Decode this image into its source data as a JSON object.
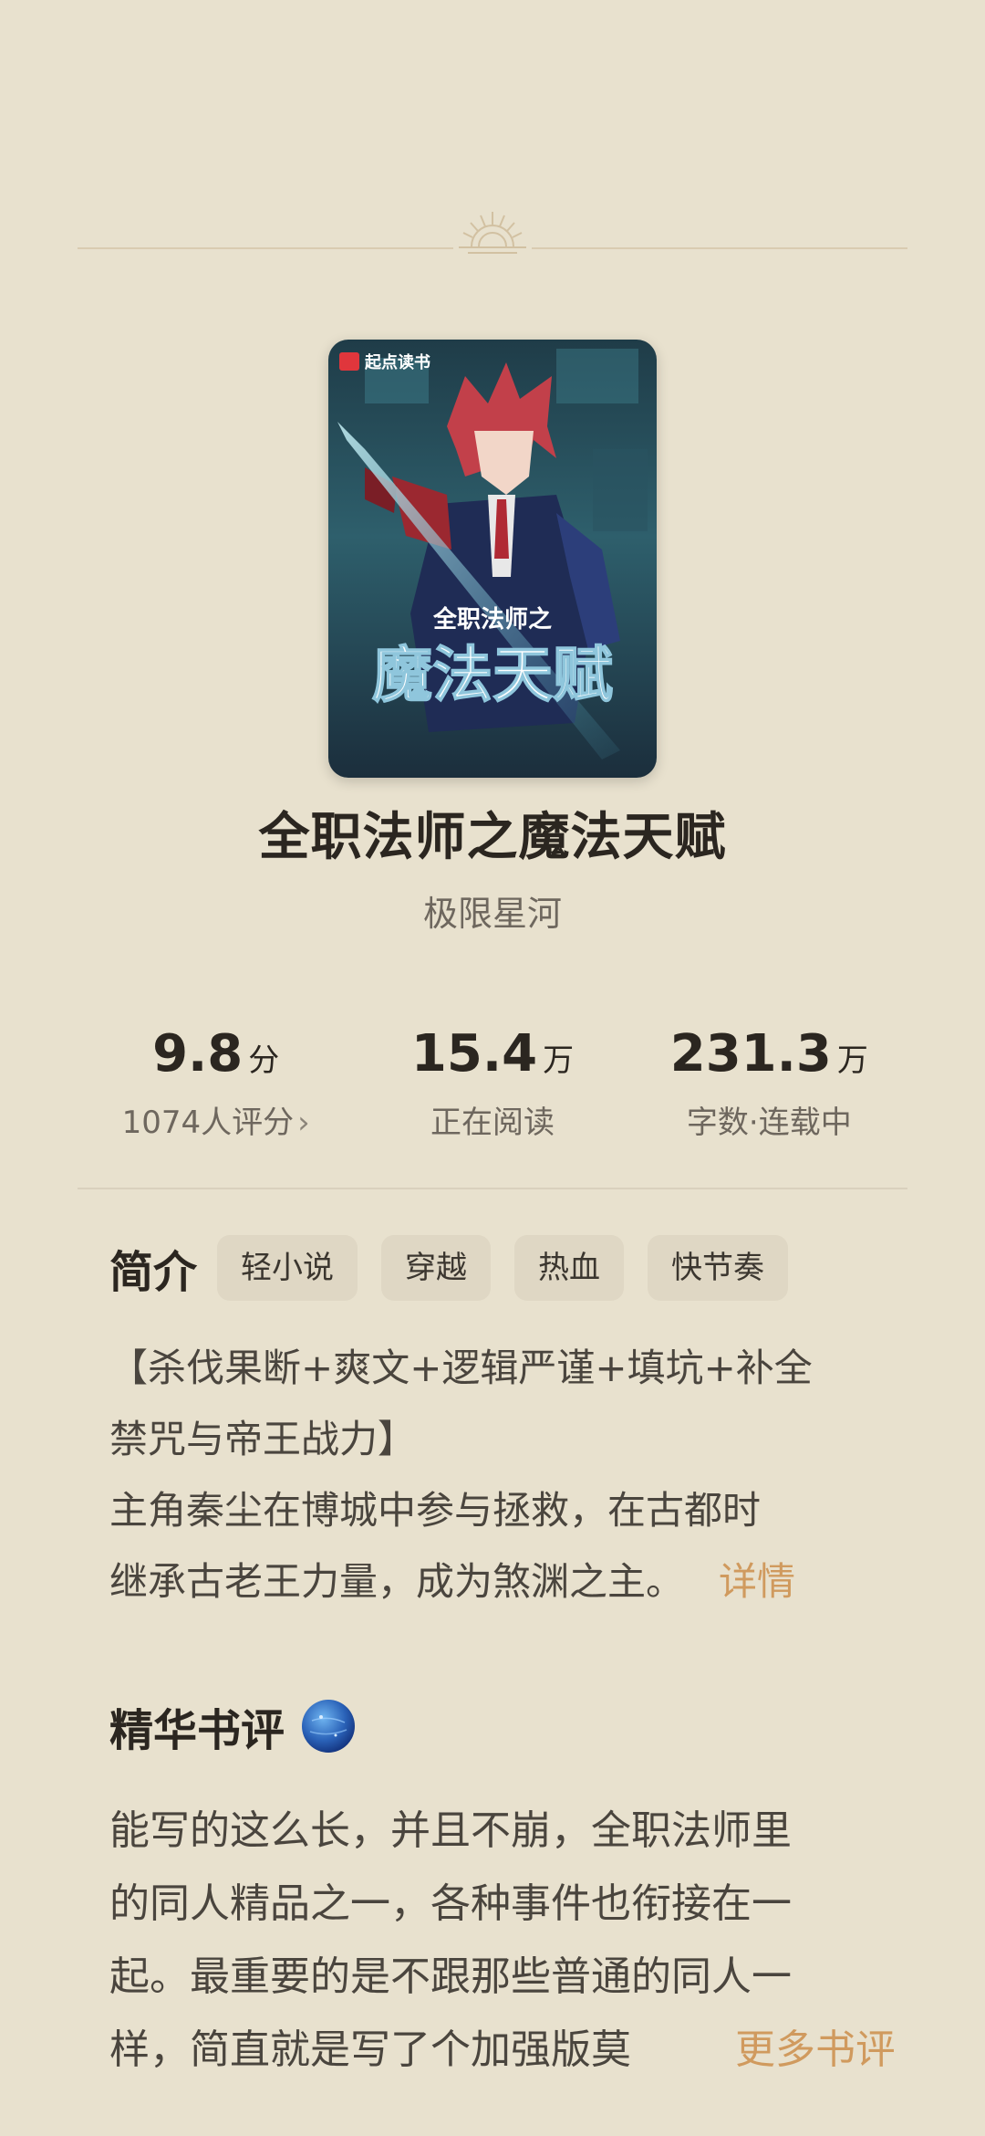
{
  "book": {
    "title": "全职法师之魔法天赋",
    "author": "极限星河",
    "cover": {
      "brand": "起点读书",
      "title_small": "全职法师之",
      "title_big": "魔法天赋"
    }
  },
  "stats": [
    {
      "value": "9.8",
      "unit": "分",
      "label": "1074人评分"
    },
    {
      "value": "15.4",
      "unit": "万",
      "label": "正在阅读"
    },
    {
      "value": "231.3",
      "unit": "万",
      "label": "字数·连载中"
    }
  ],
  "intro": {
    "title": "简介",
    "tags": [
      "轻小说",
      "穿越",
      "热血",
      "快节奏"
    ],
    "lines": [
      "【杀伐果断+爽文+逻辑严谨+填坑+补全",
      "禁咒与帝王战力】",
      "主角秦尘在博城中参与拯救，在古都时",
      "继承古老王力量，成为煞渊之主。"
    ],
    "detail_label": "详情"
  },
  "reviews": {
    "title": "精华书评",
    "lines": [
      "能写的这么长，并且不崩，全职法师里",
      "的同人精品之一，各种事件也衔接在一",
      "起。最重要的是不跟那些普通的同人一",
      "样，简直就是写了个加强版莫"
    ],
    "more_label": "更多书评"
  },
  "colors": {
    "background": "#e8e1ce",
    "accent": "#d09a5e",
    "tag_bg": "#dfd7c4"
  },
  "icons": {
    "ornament": "sun-ornament-icon",
    "chevron": "chevron-right-icon",
    "globe": "globe-icon"
  }
}
